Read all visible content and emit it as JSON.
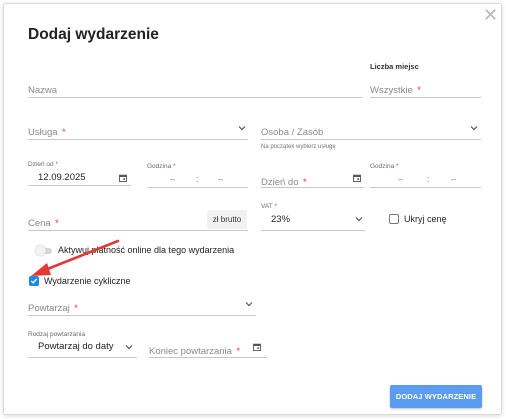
{
  "dialog": {
    "title": "Dodaj wydarzenie",
    "close_glyph": "✕"
  },
  "form": {
    "name": {
      "placeholder": "Nazwa"
    },
    "seats": {
      "heading": "Liczba miejsc",
      "placeholder": "Wszystkie",
      "required": "*"
    },
    "service": {
      "placeholder": "Usługa",
      "required": "*"
    },
    "person": {
      "placeholder": "Osoba / Zasób",
      "hint": "Na początek wybierz usługę"
    },
    "date_from": {
      "label": "Dzień od",
      "required": "*",
      "value": "12.09.2025"
    },
    "time_from": {
      "label": "Godzina",
      "required": "*",
      "hours": "–",
      "sep": ":",
      "minutes": "–"
    },
    "date_to": {
      "placeholder": "Dzień do",
      "required": "*"
    },
    "time_to": {
      "label": "Godzina",
      "required": "*",
      "hours": "–",
      "sep": ":",
      "minutes": "–"
    },
    "price": {
      "placeholder": "Cena",
      "required": "*",
      "gross_button": "zł brutto"
    },
    "vat": {
      "label": "VAT",
      "required": "*",
      "value": "23%"
    },
    "hide_price": {
      "label": "Ukryj cenę",
      "checked": false
    },
    "online_payment": {
      "label": "Aktywuj płatność online dla tego wydarzenia",
      "enabled": false
    },
    "recurring": {
      "label": "Wydarzenie cykliczne",
      "checked": true
    },
    "repeat": {
      "placeholder": "Powtarzaj",
      "required": "*"
    },
    "repeat_type": {
      "label": "Rodzaj powtarzania",
      "value": "Powtarzaj do daty"
    },
    "repeat_end": {
      "placeholder": "Koniec powtarzania",
      "required": "*"
    }
  },
  "actions": {
    "submit_label": "DODAJ WYDARZENIE"
  },
  "colors": {
    "accent": "#5c9cf0",
    "checkbox": "#1e88e5",
    "required": "#e53935",
    "annotation_arrow": "#e53935"
  },
  "icons": [
    "close-icon",
    "calendar-icon",
    "chevron-down-icon",
    "red-arrow-annotation"
  ]
}
